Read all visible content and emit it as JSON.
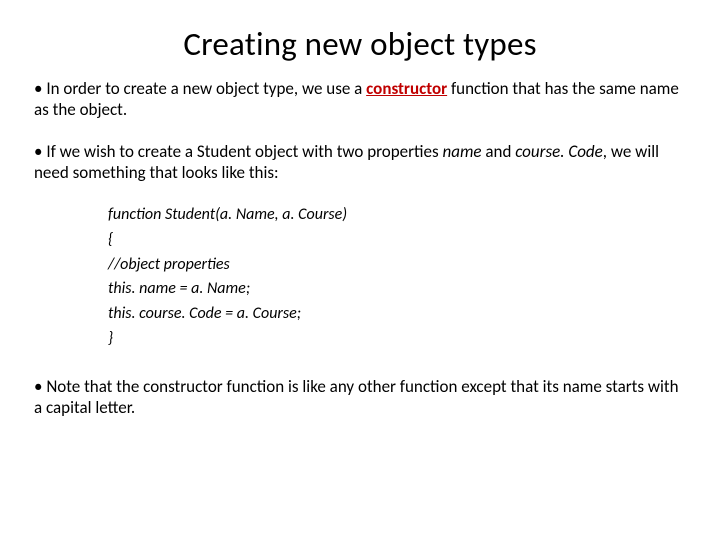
{
  "title": "Creating new object types",
  "p1": {
    "bullet": "• ",
    "t1": "In order to create a new object type, we use a ",
    "kw": "constructor",
    "t2": " function that has the same name as the object."
  },
  "p2": {
    "bullet": "• ",
    "t1": "If we wish to create a Student object with two properties ",
    "i1": "name",
    "t2": " and ",
    "i2": "course. Code",
    "t3": ", we will need something that looks like this:"
  },
  "code": {
    "l1": "function Student(a. Name, a. Course)",
    "l2": "{",
    "l3": "//object properties",
    "l4": "this. name = a. Name;",
    "l5": "this. course. Code = a. Course;",
    "l6": "}"
  },
  "p3": {
    "bullet": "• ",
    "t1": "Note that the constructor function is like any other function except that its name starts with a capital letter."
  }
}
